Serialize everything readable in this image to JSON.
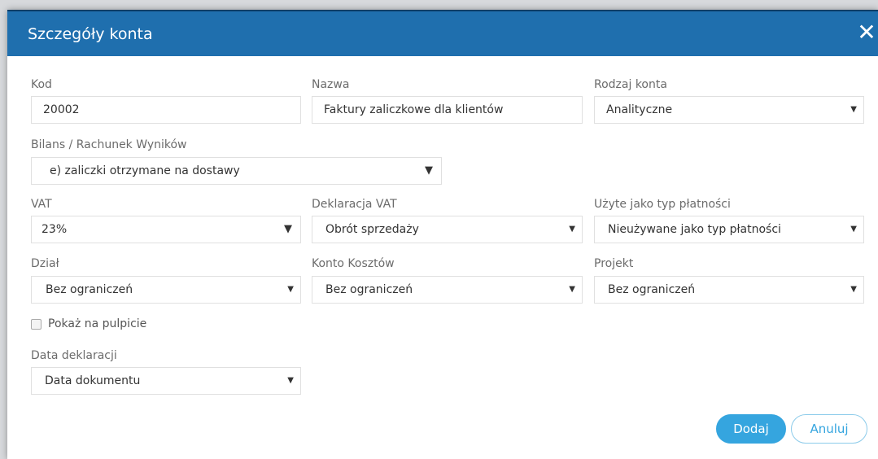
{
  "dialog": {
    "title": "Szczegóły konta",
    "close_glyph": "✕"
  },
  "fields": {
    "kod": {
      "label": "Kod",
      "value": "20002"
    },
    "nazwa": {
      "label": "Nazwa",
      "value": "Faktury zaliczkowe dla klientów"
    },
    "rodzaj": {
      "label": "Rodzaj konta",
      "value": "Analityczne"
    },
    "bilans": {
      "label": "Bilans / Rachunek Wyników",
      "value": "e) zaliczki otrzymane na dostawy"
    },
    "vat": {
      "label": "VAT",
      "value": "23%"
    },
    "deklaracja_vat": {
      "label": "Deklaracja VAT",
      "value": "Obrót sprzedaży"
    },
    "typ_platnosci": {
      "label": "Użyte jako typ płatności",
      "value": "Nieużywane jako typ płatności"
    },
    "dzial": {
      "label": "Dział",
      "value": "Bez ograniczeń"
    },
    "konto_kosztow": {
      "label": "Konto Kosztów",
      "value": "Bez ograniczeń"
    },
    "projekt": {
      "label": "Projekt",
      "value": "Bez ograniczeń"
    },
    "data_deklaracji": {
      "label": "Data deklaracji",
      "value": "Data dokumentu"
    }
  },
  "checkbox": {
    "label": "Pokaż na pulpicie",
    "checked": false
  },
  "buttons": {
    "add": "Dodaj",
    "cancel": "Anuluj"
  },
  "icons": {
    "caret": "▼"
  },
  "colors": {
    "header": "#1f6fae",
    "primary": "#35a5df"
  }
}
